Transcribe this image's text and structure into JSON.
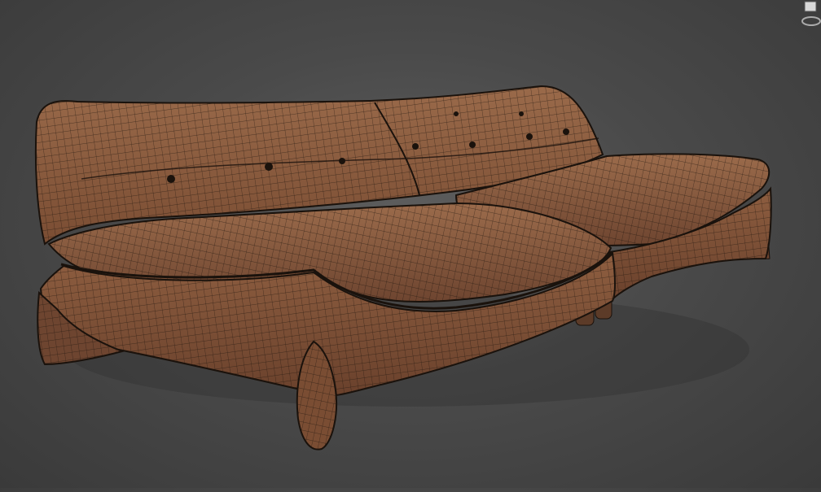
{
  "viewport": {
    "background_top": "#5e5e5e",
    "background_bottom": "#3a3a3a",
    "display_mode": "wireframe-on-shaded"
  },
  "model": {
    "object": "sofa",
    "material_color": "#8a5a3e",
    "wire_color": "#1a120c",
    "tufted_buttons_visible": 9
  },
  "viewcube": {
    "icon": "viewcube-icon"
  }
}
